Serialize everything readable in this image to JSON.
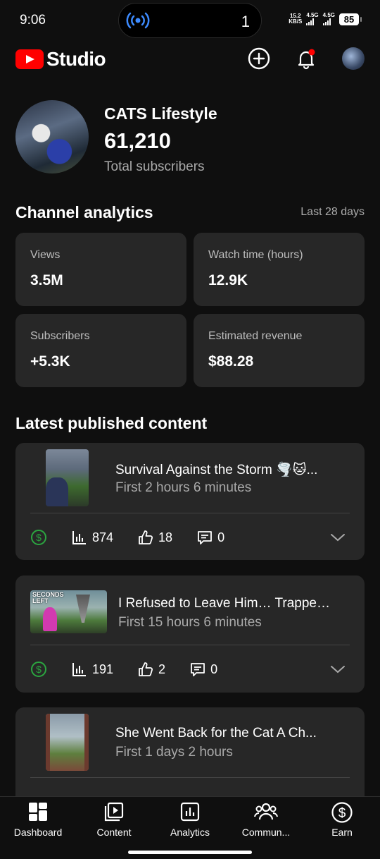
{
  "status_bar": {
    "time": "9:06",
    "island_count": "1",
    "speed_value": "15.2",
    "speed_unit": "KB/S",
    "net1": "4.5G",
    "net2": "4.5G",
    "battery": "85"
  },
  "header": {
    "logo_text": "Studio",
    "icons": [
      "create-icon",
      "notifications-icon",
      "account-avatar"
    ],
    "brand_color": "#ff0000"
  },
  "channel": {
    "name": "CATS Lifestyle",
    "subscribers": "61,210",
    "subscribers_label": "Total subscribers"
  },
  "analytics": {
    "title": "Channel analytics",
    "period": "Last 28 days",
    "cards": [
      {
        "label": "Views",
        "value": "3.5M"
      },
      {
        "label": "Watch time (hours)",
        "value": "12.9K"
      },
      {
        "label": "Subscribers",
        "value": "+5.3K"
      },
      {
        "label": "Estimated revenue",
        "value": "$88.28"
      }
    ]
  },
  "latest": {
    "title": "Latest published content",
    "items": [
      {
        "title": "Survival Against the Storm 🌪️🐱...",
        "subtitle": "First 2 hours 6 minutes",
        "views": "874",
        "likes": "18",
        "comments": "0"
      },
      {
        "title": "I Refused to Leave Him… Trappe…",
        "subtitle": "First 15 hours 6 minutes",
        "views": "191",
        "likes": "2",
        "comments": "0",
        "thumb_text": "SECONDS LEFT"
      },
      {
        "title": "She Went Back for the Cat A Ch...",
        "subtitle": "First 1 days 2 hours"
      }
    ]
  },
  "bottom_nav": [
    {
      "label": "Dashboard",
      "icon": "dashboard-icon"
    },
    {
      "label": "Content",
      "icon": "content-icon"
    },
    {
      "label": "Analytics",
      "icon": "analytics-icon"
    },
    {
      "label": "Commun...",
      "icon": "community-icon"
    },
    {
      "label": "Earn",
      "icon": "earn-icon"
    }
  ],
  "colors": {
    "background": "#0f0f0f",
    "card": "#272727",
    "monetization": "#2ba640",
    "secondary_text": "#aaaaaa"
  }
}
